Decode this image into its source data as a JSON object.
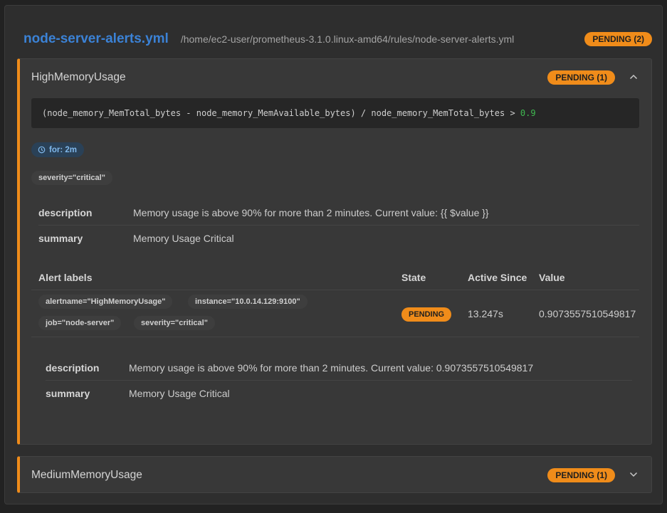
{
  "file": {
    "title": "node-server-alerts.yml",
    "path": "/home/ec2-user/prometheus-3.1.0.linux-amd64/rules/node-server-alerts.yml",
    "badge": "PENDING (2)"
  },
  "rules": [
    {
      "name": "HighMemoryUsage",
      "badge": "PENDING (1)",
      "expanded": true,
      "expr": "(node_memory_MemTotal_bytes - node_memory_MemAvailable_bytes) / node_memory_MemTotal_bytes > ",
      "expr_threshold": "0.9",
      "for": "for: 2m",
      "labels": [
        "severity=\"critical\""
      ],
      "annotations": [
        {
          "key": "description",
          "value": "Memory usage is above 90% for more than 2 minutes. Current value: {{ $value }}"
        },
        {
          "key": "summary",
          "value": "Memory Usage Critical"
        }
      ],
      "alerts_table": {
        "headers": [
          "Alert labels",
          "State",
          "Active Since",
          "Value"
        ],
        "rows": [
          {
            "labels": [
              "alertname=\"HighMemoryUsage\"",
              "instance=\"10.0.14.129:9100\"",
              "job=\"node-server\"",
              "severity=\"critical\""
            ],
            "state": "PENDING",
            "active_since": "13.247s",
            "value": "0.9073557510549817",
            "annotations": [
              {
                "key": "description",
                "value": "Memory usage is above 90% for more than 2 minutes. Current value: 0.9073557510549817"
              },
              {
                "key": "summary",
                "value": "Memory Usage Critical"
              }
            ]
          }
        ]
      }
    },
    {
      "name": "MediumMemoryUsage",
      "badge": "PENDING (1)",
      "expanded": false
    }
  ],
  "colors": {
    "accent": "#f08c1a",
    "title_blue": "#3b82d6",
    "threshold_green": "#3fb950",
    "for_pill": "#2a4157"
  },
  "icons": {
    "collapse": "chevron-up-icon",
    "expand": "chevron-down-icon",
    "for": "clock-icon"
  }
}
